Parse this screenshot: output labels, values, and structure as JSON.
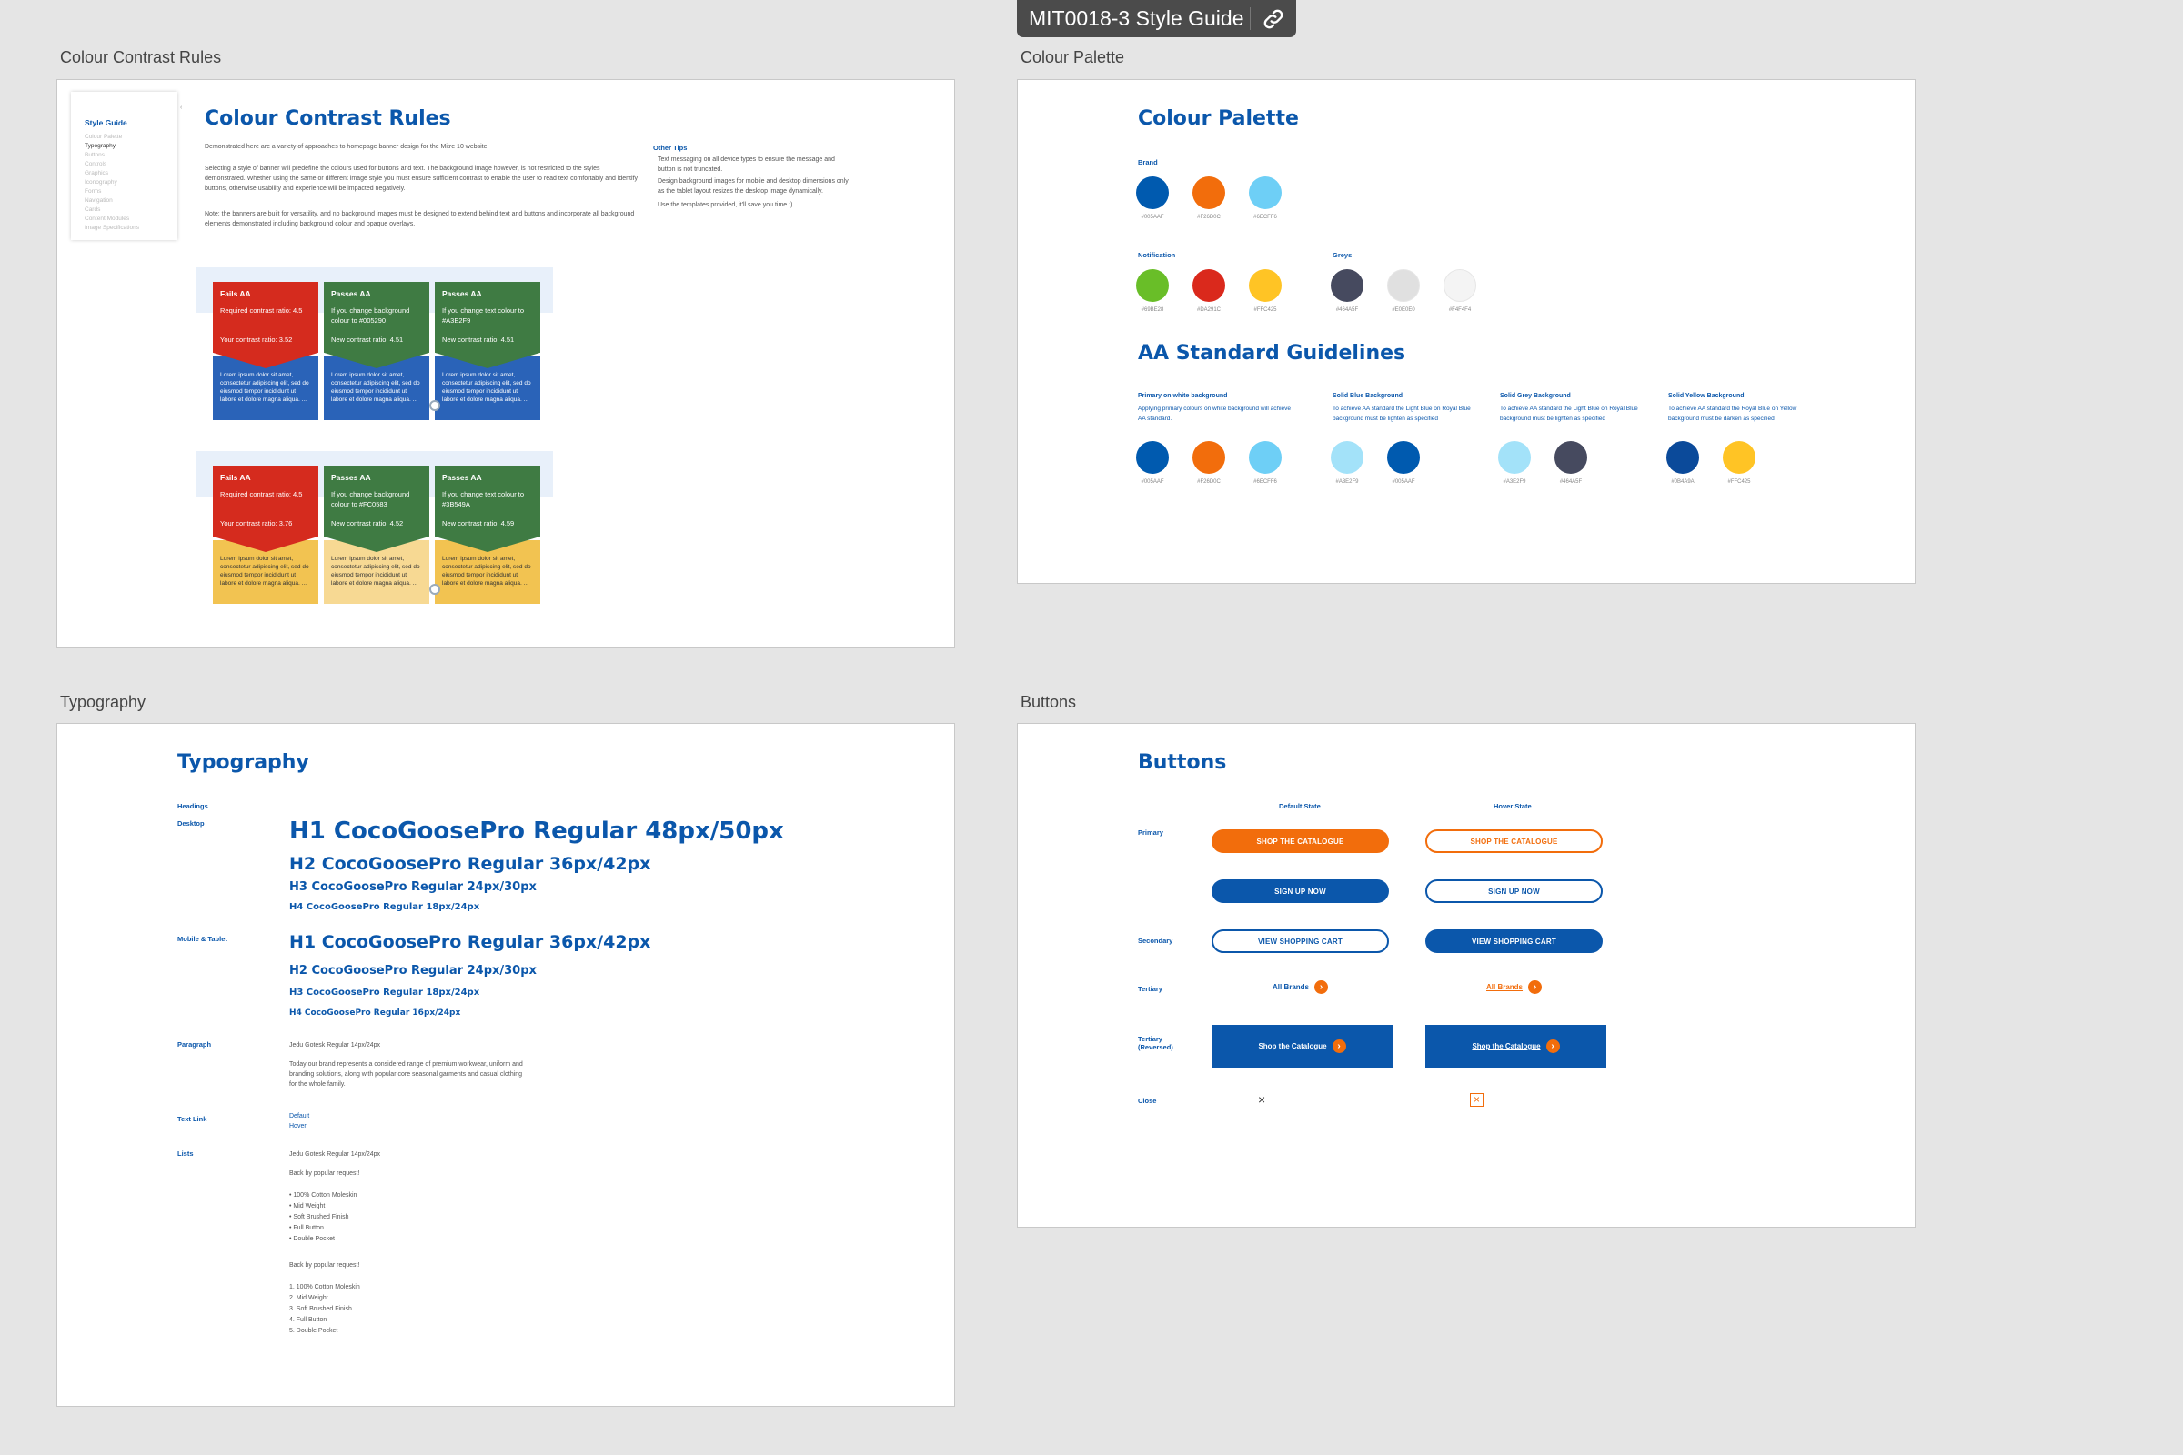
{
  "file_tag": {
    "title": "MIT0018-3 Style Guide",
    "link_icon": "link-icon"
  },
  "frames": {
    "contrast": "Colour Contrast Rules",
    "palette": "Colour Palette",
    "typography": "Typography",
    "buttons": "Buttons"
  },
  "contrast": {
    "sidebar": {
      "title": "Style Guide",
      "items": [
        "Colour Palette",
        "Typography",
        "Buttons",
        "Controls",
        "Graphics",
        "Iconography",
        "Forms",
        "Navigation",
        "Cards",
        "Content Modules",
        "Image Specifications"
      ]
    },
    "title": "Colour Contrast Rules",
    "intro": "Demonstrated here are a variety of approaches to homepage banner design for the Mitre 10 website.",
    "p2": "Selecting a style of banner will predefine the colours used for buttons and text. The background image however, is not restricted to the styles demonstrated. Whether using the same or different image style you must ensure sufficient contrast to enable the user to read text comfortably and identify buttons, otherwise usability and experience will be impacted negatively.",
    "p3": "Note: the banners are built for versatility, and no background images must be designed to extend behind text and buttons and incorporate all background elements demonstrated including background colour and opaque overlays.",
    "tips_title": "Other Tips",
    "tips": [
      "Text messaging on all device types to ensure the message and button is not truncated.",
      "Design background images for mobile and desktop dimensions only as the tablet layout resizes the desktop image dynamically.",
      "Use the templates provided, it'll save you time :)"
    ],
    "row1": [
      {
        "h": "Fails AA",
        "l1": "Required contrast ratio: 4.5",
        "l2": "Your contrast ratio: 3.52",
        "body": "Lorem ipsum dolor sit amet, consectetur adipiscing elit, sed do eiusmod tempor incididunt ut labore et dolore magna aliqua. ..."
      },
      {
        "h": "Passes AA",
        "l1": "If you change background colour to #005290",
        "l2": "New contrast ratio: 4.51",
        "body": "Lorem ipsum dolor sit amet, consectetur adipiscing elit, sed do eiusmod tempor incididunt ut labore et dolore magna aliqua. ..."
      },
      {
        "h": "Passes AA",
        "l1": "If you change text colour to #A3E2F9",
        "l2": "New contrast ratio: 4.51",
        "body": "Lorem ipsum dolor sit amet, consectetur adipiscing elit, sed do eiusmod tempor incididunt ut labore et dolore magna aliqua. ..."
      }
    ],
    "row2": [
      {
        "h": "Fails AA",
        "l1": "Required contrast ratio: 4.5",
        "l2": "Your contrast ratio: 3.76",
        "body": "Lorem ipsum dolor sit amet, consectetur adipiscing elit, sed do eiusmod tempor incididunt ut labore et dolore magna aliqua. ..."
      },
      {
        "h": "Passes AA",
        "l1": "If you change background colour to #FC0583",
        "l2": "New contrast ratio: 4.52",
        "body": "Lorem ipsum dolor sit amet, consectetur adipiscing elit, sed do eiusmod tempor incididunt ut labore et dolore magna aliqua. ..."
      },
      {
        "h": "Passes AA",
        "l1": "If you change text colour to #3B549A",
        "l2": "New contrast ratio: 4.59",
        "body": "Lorem ipsum dolor sit amet, consectetur adipiscing elit, sed do eiusmod tempor incididunt ut labore et dolore magna aliqua. ..."
      }
    ]
  },
  "palette": {
    "title": "Colour Palette",
    "brand_label": "Brand",
    "brand": [
      {
        "hex": "#005AAF",
        "color": "#005aaf"
      },
      {
        "hex": "#F26D0C",
        "color": "#f26d0c"
      },
      {
        "hex": "#6ECFF6",
        "color": "#6ecff6"
      }
    ],
    "notification_label": "Notification",
    "notification": [
      {
        "hex": "#69BE28",
        "color": "#69be28"
      },
      {
        "hex": "#DA291C",
        "color": "#da291c"
      },
      {
        "hex": "#FFC425",
        "color": "#ffc425"
      }
    ],
    "greys_label": "Greys",
    "greys": [
      {
        "hex": "#464A5F",
        "color": "#464a5f"
      },
      {
        "hex": "#E0E0E0",
        "color": "#e0e0e0"
      },
      {
        "hex": "#F4F4F4",
        "color": "#f4f4f4"
      }
    ],
    "aa_title": "AA Standard Guidelines",
    "groups": [
      {
        "title": "Primary on white background",
        "desc": "Applying primary colours on white background will achieve AA standard.",
        "sw": [
          {
            "hex": "#005AAF",
            "color": "#005aaf"
          },
          {
            "hex": "#F26D0C",
            "color": "#f26d0c"
          },
          {
            "hex": "#6ECFF6",
            "color": "#6ecff6"
          }
        ]
      },
      {
        "title": "Solid Blue Background",
        "desc": "To achieve AA standard the Light Blue on Royal Blue background must be lighten as specified",
        "sw": [
          {
            "hex": "#A3E2F9",
            "color": "#a3e2f9"
          },
          {
            "hex": "#005AAF",
            "color": "#005aaf"
          }
        ]
      },
      {
        "title": "Solid Grey Background",
        "desc": "To achieve AA standard the Light Blue on Royal Blue background must be lighten as specified",
        "sw": [
          {
            "hex": "#A3E2F9",
            "color": "#a3e2f9"
          },
          {
            "hex": "#464A5F",
            "color": "#464a5f"
          }
        ]
      },
      {
        "title": "Solid Yellow Background",
        "desc": "To achieve AA standard the Royal Blue on Yellow background must be darken as specified",
        "sw": [
          {
            "hex": "#0B4A9A",
            "color": "#0b4a9a"
          },
          {
            "hex": "#FFC425",
            "color": "#ffc425"
          }
        ]
      }
    ]
  },
  "typography": {
    "title": "Typography",
    "headings_label": "Headings",
    "desktop_label": "Desktop",
    "desktop": [
      "H1 CocoGoosePro Regular 48px/50px",
      "H2 CocoGoosePro Regular 36px/42px",
      "H3 CocoGoosePro Regular 24px/30px",
      "H4 CocoGoosePro Regular 18px/24px"
    ],
    "mobile_label": "Mobile & Tablet",
    "mobile": [
      "H1 CocoGoosePro Regular 36px/42px",
      "H2 CocoGoosePro Regular 24px/30px",
      "H3 CocoGoosePro Regular 18px/24px",
      "H4 CocoGoosePro Regular 16px/24px"
    ],
    "paragraph_label": "Paragraph",
    "paragraph_spec": "Jedu Gotesk Regular 14px/24px",
    "paragraph_text": "Today our brand represents a considered range of premium workwear, uniform and branding solutions, along with popular core seasonal garments and casual clothing for the whole family.",
    "textlink_label": "Text Link",
    "textlink_default": "Default",
    "textlink_hover": "Hover",
    "lists_label": "Lists",
    "lists_spec": "Jedu Gotesk Regular 14px/24px",
    "list_intro": "Back by popular request!",
    "bullets": [
      "• 100% Cotton Moleskin",
      "• Mid Weight",
      "• Soft Brushed Finish",
      "• Full Button",
      "• Double Pocket"
    ],
    "list_intro2": "Back by popular request!",
    "numbered": [
      "1. 100% Cotton Moleskin",
      "2. Mid Weight",
      "3. Soft Brushed Finish",
      "4. Full Button",
      "5. Double Pocket"
    ]
  },
  "buttons": {
    "title": "Buttons",
    "default_state": "Default State",
    "hover_state": "Hover State",
    "primary_label": "Primary",
    "secondary_label": "Secondary",
    "tertiary_label": "Tertiary",
    "tertiary_rev_label": "Tertiary (Reversed)",
    "close_label": "Close",
    "shop_catalogue": "SHOP THE CATALOGUE",
    "sign_up": "SIGN UP NOW",
    "view_cart": "VIEW SHOPPING CART",
    "all_brands": "All Brands",
    "shop_catalogue_rev": "Shop the Catalogue",
    "close_glyph": "×",
    "colors": {
      "orange": "#f26d0c",
      "navy": "#0b57ab"
    }
  }
}
